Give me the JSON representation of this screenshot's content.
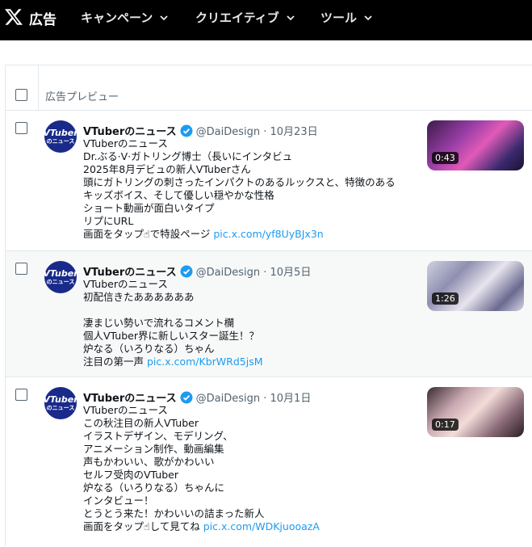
{
  "topbar": {
    "brand": "広告",
    "nav": [
      {
        "label": "キャンペーン"
      },
      {
        "label": "クリエイティブ"
      },
      {
        "label": "ツール"
      }
    ]
  },
  "table": {
    "header_label": "広告プレビュー"
  },
  "posts": [
    {
      "account_name": "VTuberのニュース",
      "handle_date": "@DaiDesign · 10月23日",
      "lines": [
        "VTuberのニュース",
        "Dr.ぶる·V·ガトリング博士（長いにインタビュ",
        "2025年8月デビュの新人VTuberさん",
        "頭にガトリングの刺さったインパクトのあるルックスと、特徴のある",
        "キッズボイス、そして優しい穏やかな性格",
        "ショート動画が面白いタイプ",
        "リプにURL"
      ],
      "last_line_text": "画面をタップ☝で特設ページ ",
      "link": "pic.x.com/yf8UyBJx3n",
      "duration": "0:43"
    },
    {
      "account_name": "VTuberのニュース",
      "handle_date": "@DaiDesign · 10月5日",
      "lines": [
        "VTuberのニュース",
        "初配信きたああああああ",
        "",
        "凄まじい勢いで流れるコメント欄",
        "個人VTuber界に新しいスター誕生！？",
        "炉なる（いろりなる）ちゃん"
      ],
      "last_line_text": "注目の第一声 ",
      "link": "pic.x.com/KbrWRd5jsM",
      "duration": "1:26"
    },
    {
      "account_name": "VTuberのニュース",
      "handle_date": "@DaiDesign · 10月1日",
      "lines": [
        "VTuberのニュース",
        "この秋注目の新人VTuber",
        "イラストデザイン、モデリング、",
        "アニメーション制作、動画編集",
        "声もかわいい、歌がかわいい",
        "セルフ受肉のVTuber",
        "炉なる（いろりなる）ちゃんに",
        "インタビュー！",
        "とうとう来た！かわいいの詰まった新人"
      ],
      "last_line_text": "画面をタップ☝して見てね ",
      "link": "pic.x.com/WDKjuooazA",
      "duration": "0:17"
    }
  ],
  "avatar_text": {
    "line1": "VTuber",
    "line2": "のニュース"
  },
  "colors": {
    "topbar": "#000000",
    "link": "#1d9bf0",
    "verified": "#1d9bf0",
    "avatar": "#1a2a8a"
  }
}
